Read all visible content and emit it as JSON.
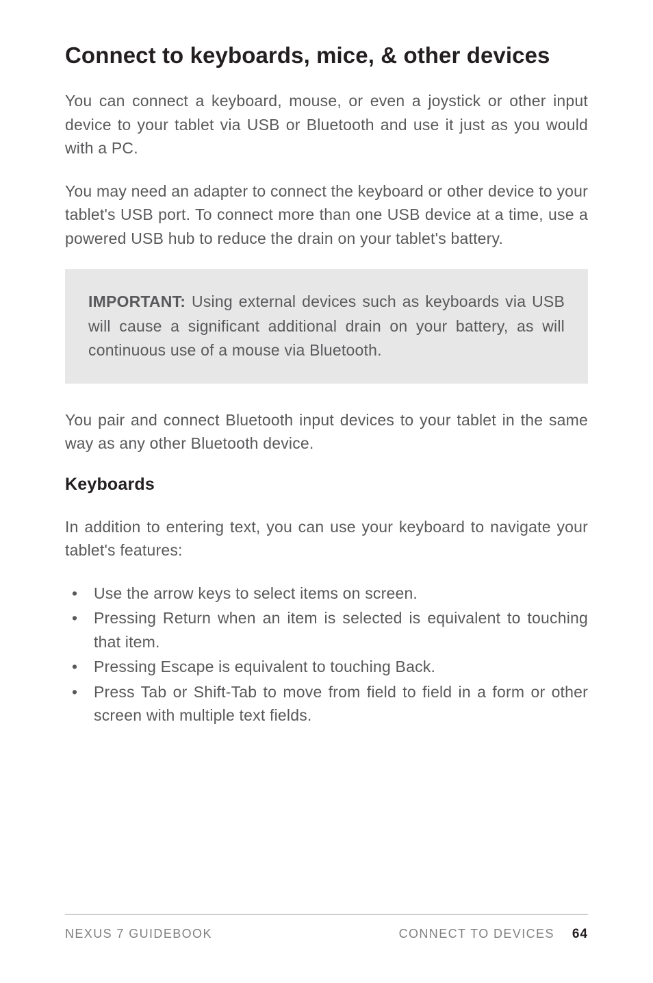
{
  "heading": "Connect to keyboards, mice, & other devices",
  "para1": "You can connect a keyboard, mouse, or even a joystick or other input device to your tablet via USB or Bluetooth and use it just as you would with a PC.",
  "para2": "You may need an adapter to connect the keyboard or other device to your tablet's USB port. To connect more than one USB device at a time, use a powered USB hub to reduce the drain on your tablet's battery.",
  "callout": {
    "label": "IMPORTANT:",
    "text": " Using external devices such as keyboards via USB will cause a significant additional drain on your battery, as will continuous use of a mouse via Bluetooth."
  },
  "para3": "You pair and connect Bluetooth input devices to your tablet in the same way as any other Bluetooth device.",
  "subheading": "Keyboards",
  "para4": "In addition to entering text, you can use your keyboard to navigate your tablet's features:",
  "bullets": [
    "Use the arrow keys to select items on screen.",
    "Pressing Return when an item is selected is equivalent to touching that item.",
    "Pressing Escape is equivalent to touching Back.",
    "Press Tab or Shift-Tab to move from field to field in a form or other screen with multiple text fields."
  ],
  "footer": {
    "left": "NEXUS 7 GUIDEBOOK",
    "right": "CONNECT TO DEVICES",
    "page": "64"
  }
}
